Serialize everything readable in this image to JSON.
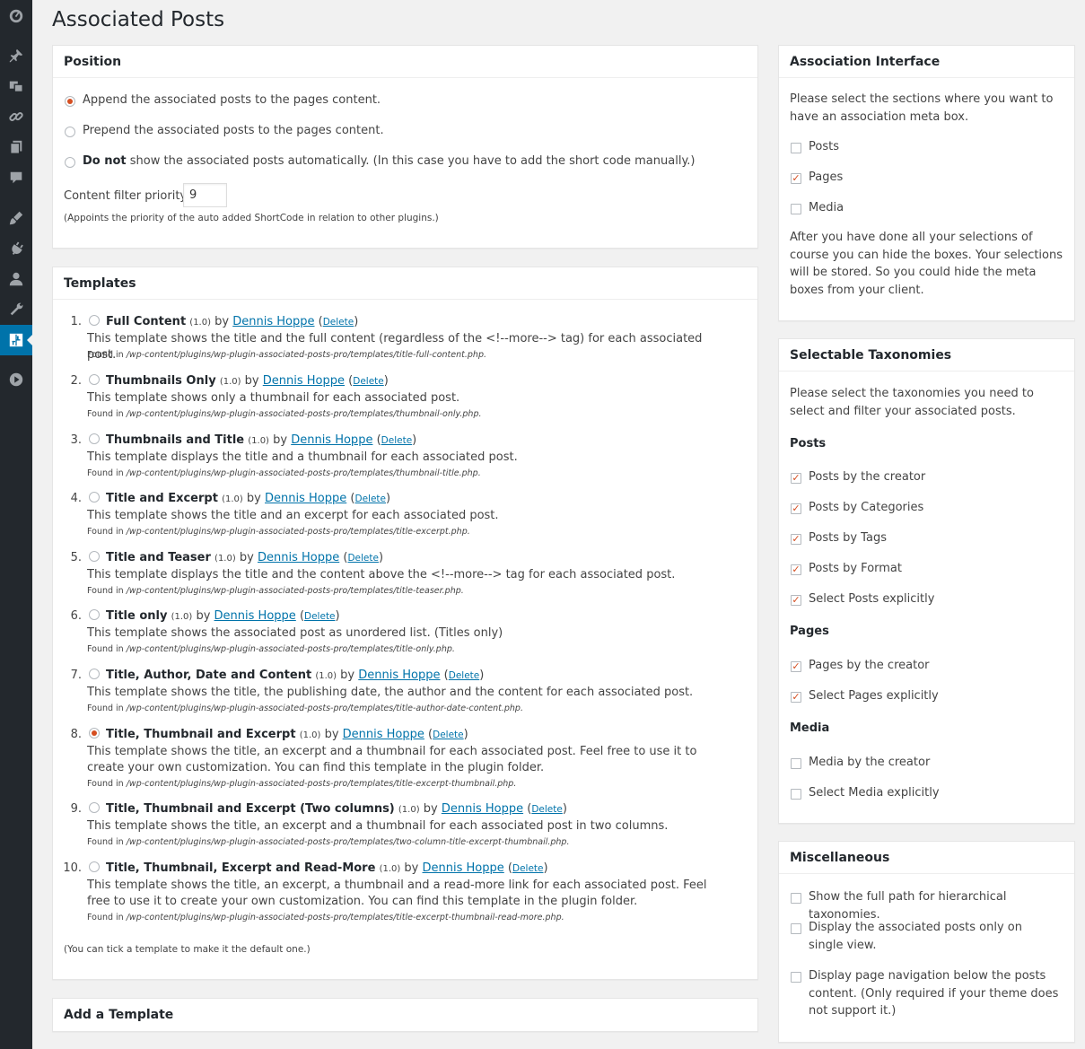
{
  "page_title": "Associated Posts",
  "colors": {
    "accent": "#d54e21",
    "link": "#0073aa",
    "admin_bar": "#23282d",
    "active_menu": "#0073aa"
  },
  "sidebar": {
    "icons": [
      "dashboard-icon",
      "pin-icon",
      "media-icon",
      "links-icon",
      "pages-icon",
      "comments-icon",
      "appearance-icon",
      "plugins-icon",
      "users-icon",
      "tools-icon",
      "associated-posts-icon",
      "collapse-icon"
    ]
  },
  "position": {
    "title": "Position",
    "options": [
      {
        "label": "Append the associated posts to the pages content.",
        "checked": true
      },
      {
        "label": "Prepend the associated posts to the pages content.",
        "checked": false
      },
      {
        "label_strong": "Do not",
        "label": " show the associated posts automatically. (In this case you have to add the short code manually.)",
        "checked": false
      }
    ],
    "priority_label": "Content filter priority:",
    "priority_value": "9",
    "priority_help": "(Appoints the priority of the auto added ShortCode in relation to other plugins.)"
  },
  "templates": {
    "title": "Templates",
    "author": "Dennis Hoppe",
    "delete_label": "Delete",
    "found_prefix": "Found in",
    "items": [
      {
        "num": "1.",
        "name": "Full Content",
        "version": "(1.0)",
        "checked": false,
        "desc": "This template shows the title and the full content (regardless of the <!--more--> tag) for each associated post.",
        "path": "/wp-content/plugins/wp-plugin-associated-posts-pro/templates/title-full-content.php."
      },
      {
        "num": "2.",
        "name": "Thumbnails Only",
        "version": "(1.0)",
        "checked": false,
        "desc": "This template shows only a thumbnail for each associated post.",
        "path": "/wp-content/plugins/wp-plugin-associated-posts-pro/templates/thumbnail-only.php."
      },
      {
        "num": "3.",
        "name": "Thumbnails and Title",
        "version": "(1.0)",
        "checked": false,
        "desc": "This template displays the title and a thumbnail for each associated post.",
        "path": "/wp-content/plugins/wp-plugin-associated-posts-pro/templates/thumbnail-title.php."
      },
      {
        "num": "4.",
        "name": "Title and Excerpt",
        "version": "(1.0)",
        "checked": false,
        "desc": "This template shows the title and an excerpt for each associated post.",
        "path": "/wp-content/plugins/wp-plugin-associated-posts-pro/templates/title-excerpt.php."
      },
      {
        "num": "5.",
        "name": "Title and Teaser",
        "version": "(1.0)",
        "checked": false,
        "desc": "This template displays the title and the content above the <!--more--> tag for each associated post.",
        "path": "/wp-content/plugins/wp-plugin-associated-posts-pro/templates/title-teaser.php."
      },
      {
        "num": "6.",
        "name": "Title only",
        "version": "(1.0)",
        "checked": false,
        "desc": "This template shows the associated post as unordered list. (Titles only)",
        "path": "/wp-content/plugins/wp-plugin-associated-posts-pro/templates/title-only.php."
      },
      {
        "num": "7.",
        "name": "Title, Author, Date and Content",
        "version": "(1.0)",
        "checked": false,
        "desc": "This template shows the title, the publishing date, the author and the content for each associated post.",
        "path": "/wp-content/plugins/wp-plugin-associated-posts-pro/templates/title-author-date-content.php."
      },
      {
        "num": "8.",
        "name": "Title, Thumbnail and Excerpt",
        "version": "(1.0)",
        "checked": true,
        "desc": "This template shows the title, an excerpt and a thumbnail for each associated post. Feel free to use it to create your own customization. You can find this template in the plugin folder.",
        "path": "/wp-content/plugins/wp-plugin-associated-posts-pro/templates/title-excerpt-thumbnail.php."
      },
      {
        "num": "9.",
        "name": "Title, Thumbnail and Excerpt (Two columns)",
        "version": "(1.0)",
        "checked": false,
        "desc": "This template shows the title, an excerpt and a thumbnail for each associated post in two columns.",
        "path": "/wp-content/plugins/wp-plugin-associated-posts-pro/templates/two-column-title-excerpt-thumbnail.php."
      },
      {
        "num": "10.",
        "name": "Title, Thumbnail, Excerpt and Read-More",
        "version": "(1.0)",
        "checked": false,
        "desc": "This template shows the title, an excerpt, a thumbnail and a read-more link for each associated post. Feel free to use it to create your own customization. You can find this template in the plugin folder.",
        "path": "/wp-content/plugins/wp-plugin-associated-posts-pro/templates/title-excerpt-thumbnail-read-more.php."
      }
    ],
    "footnote": "(You can tick a template to make it the default one.)"
  },
  "add_template": {
    "title": "Add a Template"
  },
  "association_interface": {
    "title": "Association Interface",
    "intro": "Please select the sections where you want to have an association meta box.",
    "options": [
      {
        "label": "Posts",
        "checked": false
      },
      {
        "label": "Pages",
        "checked": true
      },
      {
        "label": "Media",
        "checked": false
      }
    ],
    "note": "After you have done all your selections of course you can hide the boxes. Your selections will be stored. So you could hide the meta boxes from your client."
  },
  "taxonomies": {
    "title": "Selectable Taxonomies",
    "intro": "Please select the taxonomies you need to select and filter your associated posts.",
    "groups": [
      {
        "name": "Posts",
        "options": [
          {
            "label": "Posts by the creator",
            "checked": true
          },
          {
            "label": "Posts by Categories",
            "checked": true
          },
          {
            "label": "Posts by Tags",
            "checked": true
          },
          {
            "label": "Posts by Format",
            "checked": true
          },
          {
            "label": "Select Posts explicitly",
            "checked": true
          }
        ]
      },
      {
        "name": "Pages",
        "options": [
          {
            "label": "Pages by the creator",
            "checked": true
          },
          {
            "label": "Select Pages explicitly",
            "checked": true
          }
        ]
      },
      {
        "name": "Media",
        "options": [
          {
            "label": "Media by the creator",
            "checked": false
          },
          {
            "label": "Select Media explicitly",
            "checked": false
          }
        ]
      }
    ]
  },
  "misc": {
    "title": "Miscellaneous",
    "options": [
      {
        "label": "Show the full path for hierarchical taxonomies.",
        "checked": false
      },
      {
        "label": "Display the associated posts only on single view.",
        "checked": false
      },
      {
        "label": "Display page navigation below the posts content. (Only required if your theme does not support it.)",
        "checked": false
      }
    ]
  }
}
